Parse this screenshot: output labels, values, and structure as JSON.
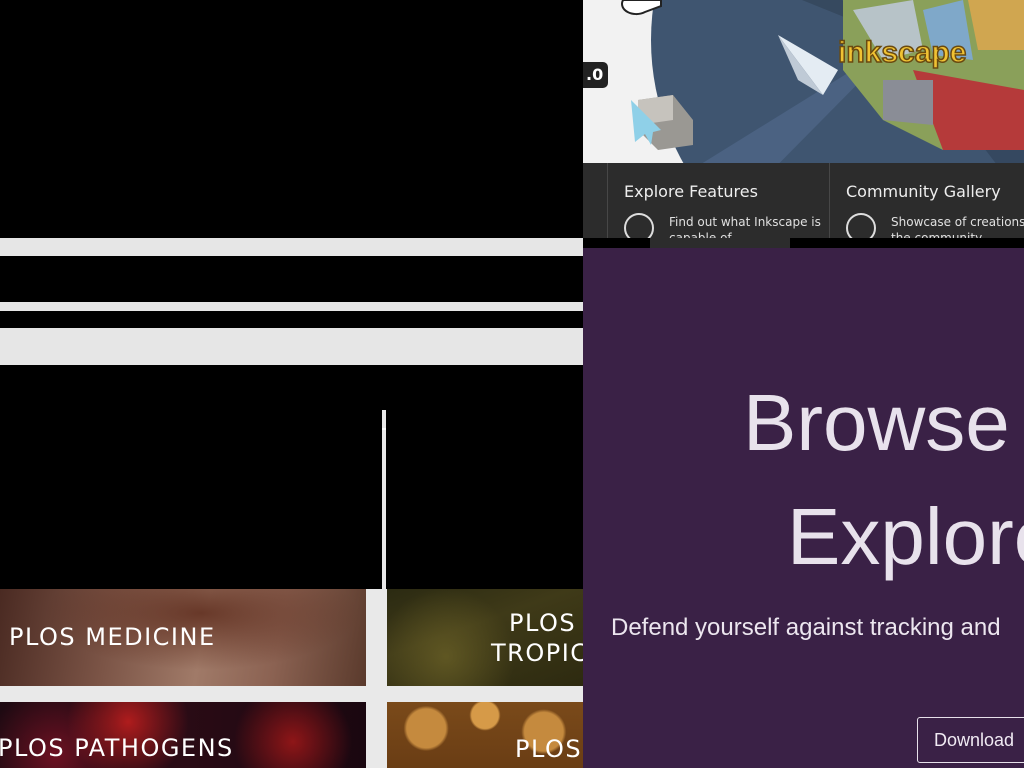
{
  "plos": {
    "tiles": [
      {
        "label_lines": [
          "PLOS MEDICINE"
        ]
      },
      {
        "label_lines": [
          "PLOS",
          "TROPIC"
        ]
      },
      {
        "label_lines": [
          "PLOS PATHOGENS"
        ]
      },
      {
        "label_lines": [
          "PLOS"
        ]
      }
    ]
  },
  "inkscape": {
    "version_badge": ".0",
    "logo_text": "inkscape",
    "nav": [
      {
        "title": "Explore Features",
        "desc_lines": [
          "Find out what Inkscape is",
          "capable of"
        ],
        "icon": "features-icon"
      },
      {
        "title": "Community Gallery",
        "desc_lines": [
          "Showcase of creations fr",
          "the community"
        ],
        "icon": "gallery-icon"
      }
    ]
  },
  "browser_promo": {
    "heading_lines": [
      "Browse",
      "Explore"
    ],
    "subtitle": "Defend yourself against tracking and",
    "download_label": "Download"
  },
  "colors": {
    "purple_bg": "#3a2146",
    "inkscape_nav_bg": "#2c2c2c",
    "gray_band": "#e6e6e6"
  }
}
